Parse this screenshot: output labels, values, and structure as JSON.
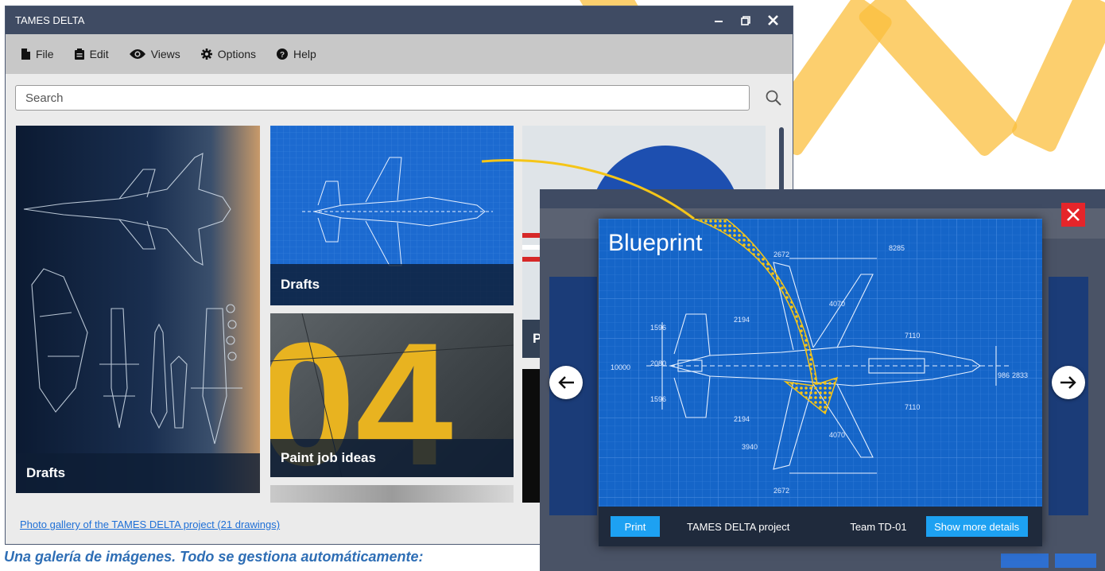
{
  "window": {
    "title": "TAMES DELTA",
    "controls": [
      "minimize",
      "restore",
      "close"
    ]
  },
  "menu": {
    "items": [
      {
        "label": "File",
        "icon": "file-icon"
      },
      {
        "label": "Edit",
        "icon": "clipboard-icon"
      },
      {
        "label": "Views",
        "icon": "eye-icon"
      },
      {
        "label": "Options",
        "icon": "gear-icon"
      },
      {
        "label": "Help",
        "icon": "help-circle-icon"
      }
    ]
  },
  "search": {
    "placeholder": "Search"
  },
  "gallery": {
    "tiles": [
      {
        "caption": "Drafts"
      },
      {
        "caption": "Drafts"
      },
      {
        "caption": "Paint job ideas"
      },
      {
        "caption": "P"
      }
    ],
    "footer_link": "Photo gallery of the TAMES DELTA project (21 drawings)"
  },
  "viewer": {
    "title": "Blueprint",
    "print_label": "Print",
    "project_label": "TAMES DELTA project",
    "team_label": "Team TD-01",
    "details_label": "Show more details",
    "dimensions": [
      "2672",
      "8285",
      "4070",
      "7110",
      "7110",
      "1596",
      "2080",
      "1596",
      "10000",
      "2194",
      "2194",
      "2672",
      "4070",
      "3940",
      "2833",
      "986"
    ]
  },
  "caption": "Una galería de imágenes. Todo se gestiona automáticamente:",
  "colors": {
    "title_bar": "#3f4b63",
    "menu_bar": "#c8c8c8",
    "blueprint": "#1565c8",
    "accent_button": "#1da1f2",
    "close_red": "#e5252a",
    "watermark": "#fbbf3e",
    "arrow": "#f5c518",
    "caption_text": "#2e6eb5"
  }
}
